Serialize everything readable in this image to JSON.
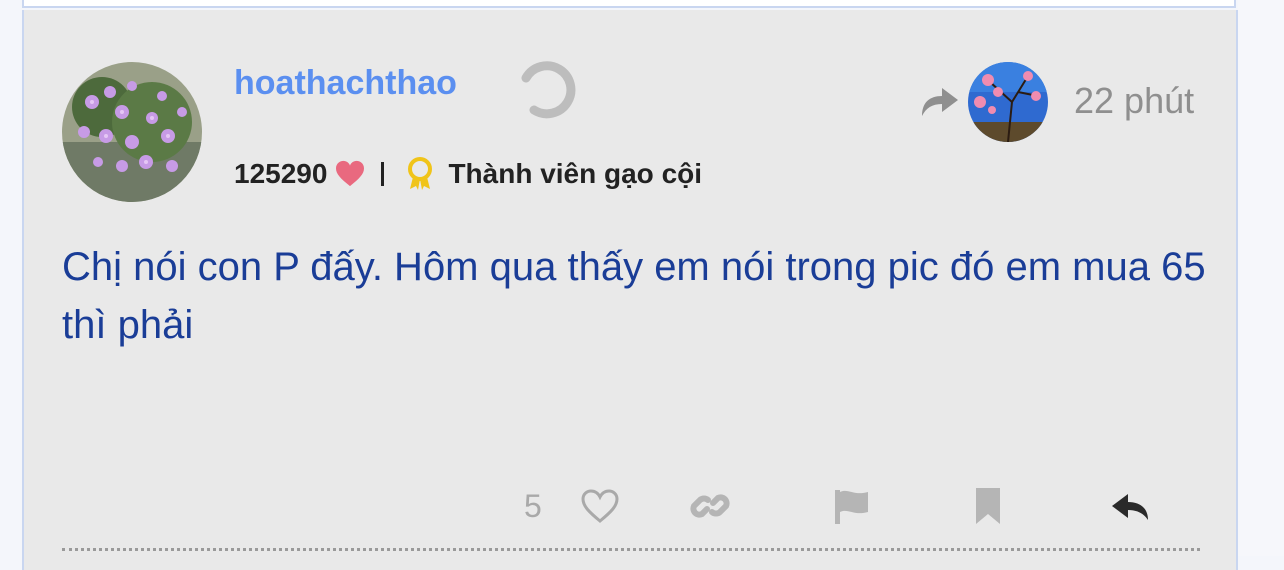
{
  "post": {
    "username": "hoathachthao",
    "points": "125290",
    "rank_title": "Thành viên gạo cội",
    "time": "22 phút",
    "content": "Chị nói con P đấy. Hôm qua thấy em nói trong pic đó em mua 65 thì phải",
    "like_count": "5"
  },
  "icons": {
    "loading": "spinner-icon",
    "heart": "heart-icon",
    "medal": "medal-icon",
    "share": "share-arrow-icon",
    "link": "link-icon",
    "flag": "flag-icon",
    "bookmark": "bookmark-icon",
    "reply": "reply-icon"
  },
  "colors": {
    "username": "#5b8ff0",
    "content": "#1a3d97",
    "heart": "#e9697f",
    "medal": "#f0c419",
    "card_bg": "#e9e9e9",
    "muted": "#a9a9a9"
  }
}
